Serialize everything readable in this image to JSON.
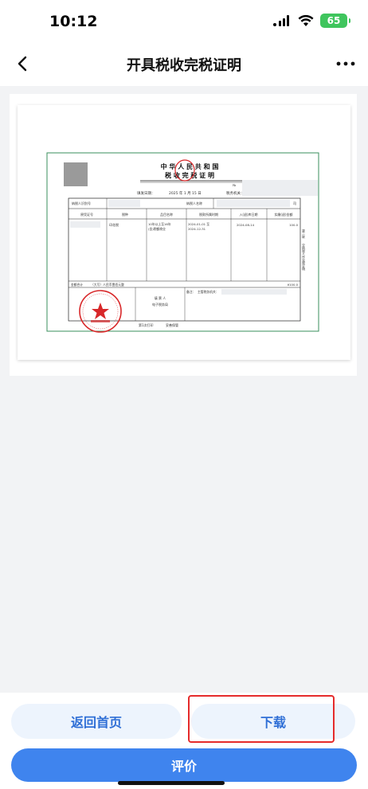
{
  "status_bar": {
    "time": "10:12",
    "battery": "65",
    "battery_color": "#3fc55d"
  },
  "nav": {
    "title": "开具税收完税证明",
    "back_icon": "chevron-left-icon",
    "more_icon": "more-dots-icon"
  },
  "certificate": {
    "title_line1": "中 华 人 民 共 和 国",
    "title_line2": "税 收 完 税 证 明",
    "fill_date_label": "填发日期：",
    "fill_date_value": "2025 年  1 月 15 日",
    "tax_authority_label": "税务机关：",
    "no_label": "№",
    "taxpayer_id_label": "纳税人识别号",
    "taxpayer_name_label": "纳税人名称",
    "name_suffix": "司",
    "columns": [
      "原凭证号",
      "税种",
      "品目名称",
      "税款所属时期",
      "入(退)库日期",
      "实缴(退)金额"
    ],
    "row": {
      "tax_type": "印花税",
      "item_line1": "10年以上至16年",
      "item_line2": "(含)税额商业",
      "period_start": "2024-01-01 至",
      "period_end": "2024-12-31",
      "entry_date": "2024-08-14",
      "amount": "100.0"
    },
    "total_label": "金额合计",
    "total_words": "（大写）人民币壹佰元整",
    "total_amount": "¥100.0",
    "preparer_label": "填 票 人",
    "e_tax_label": "电子税务局",
    "remarks_label": "备注：",
    "remarks_value": "主管税务机关：",
    "footer_print": "第1次打印",
    "footer_keep": "妥善保管",
    "side_note_1": "第二联",
    "side_note_2": "交纳税人作完税证明",
    "accent_green": "#3a8f5c",
    "seal_red": "#d8282a"
  },
  "actions": {
    "home_label": "返回首页",
    "download_label": "下载",
    "rate_label": "评价",
    "primary_color": "#3f84ee",
    "highlight_color": "#e52b2b"
  }
}
